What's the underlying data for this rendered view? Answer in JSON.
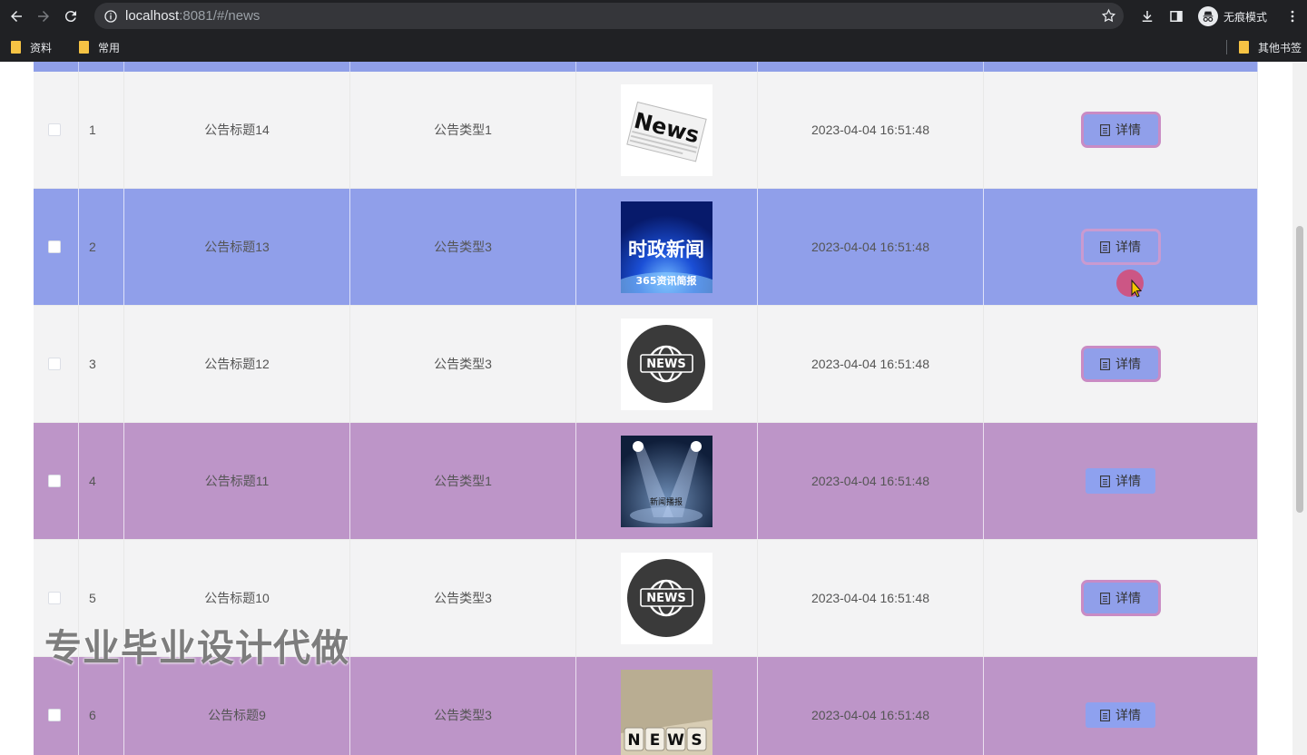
{
  "browser": {
    "url_host": "localhost",
    "url_rest": ":8081/#/news",
    "incognito_label": "无痕模式",
    "bookmarks": [
      "资料",
      "常用"
    ],
    "other_bookmarks": "其他书签"
  },
  "table": {
    "detail_label": "详情",
    "rows": [
      {
        "index": "1",
        "title": "公告标题14",
        "type": "公告类型1",
        "image": "news-newspaper",
        "time": "2023-04-04 16:51:48",
        "style": "odd"
      },
      {
        "index": "2",
        "title": "公告标题13",
        "type": "公告类型3",
        "image": "shizheng-news",
        "time": "2023-04-04 16:51:48",
        "style": "blue",
        "image_text": "时政新闻",
        "image_subtext": "365资讯简报"
      },
      {
        "index": "3",
        "title": "公告标题12",
        "type": "公告类型3",
        "image": "news-globe",
        "time": "2023-04-04 16:51:48",
        "style": "odd"
      },
      {
        "index": "4",
        "title": "公告标题11",
        "type": "公告类型1",
        "image": "spotlight-stage",
        "time": "2023-04-04 16:51:48",
        "style": "purple",
        "image_text": "新闻播报"
      },
      {
        "index": "5",
        "title": "公告标题10",
        "type": "公告类型3",
        "image": "news-globe",
        "time": "2023-04-04 16:51:48",
        "style": "odd"
      },
      {
        "index": "6",
        "title": "公告标题9",
        "type": "公告类型3",
        "image": "news-dice",
        "time": "2023-04-04 16:51:48",
        "style": "purple"
      }
    ]
  },
  "watermark": "专业毕业设计代做",
  "colors": {
    "row_blue": "#909fea",
    "row_purple": "#bd95c8",
    "row_plain": "#f3f3f4",
    "button": "#909fea",
    "button_ring": "#c98bc4"
  }
}
